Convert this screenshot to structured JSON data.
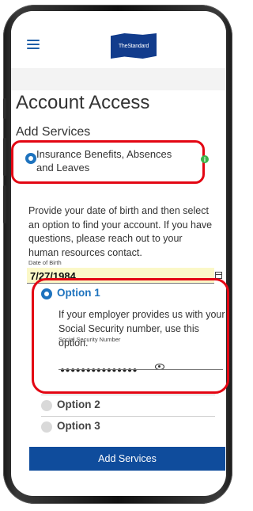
{
  "header": {
    "menu_icon": "hamburger-icon",
    "logo_text": "TheStandard"
  },
  "page": {
    "title": "Account Access",
    "subtitle": "Add Services"
  },
  "service": {
    "label": "Insurance Benefits, Absences and Leaves",
    "selected": true,
    "info_icon": "info-icon",
    "info_symbol": "i"
  },
  "form": {
    "description": "Provide your date of birth and then select an option to find your account. If you have questions, please reach out to your human resources contact.",
    "dob_label": "Date of Birth",
    "dob_value": "7/27/1984",
    "calendar_icon": "calendar-icon"
  },
  "options": [
    {
      "label": "Option 1",
      "selected": true,
      "description": "If your employer provides us with your Social Security number, use this option.",
      "ssn_label": "Social Security Number",
      "ssn_value": "●●●●●●●●●●●●●●●",
      "eye_icon": "eye-icon"
    },
    {
      "label": "Option 2",
      "selected": false
    },
    {
      "label": "Option 3",
      "selected": false
    }
  ],
  "actions": {
    "add_services_label": "Add Services"
  },
  "colors": {
    "accent_blue": "#1e73be",
    "button_blue": "#0f4c9c",
    "highlight_red": "#e30613",
    "dob_fill": "#fbf8c8",
    "info_green": "#3bb44a"
  }
}
